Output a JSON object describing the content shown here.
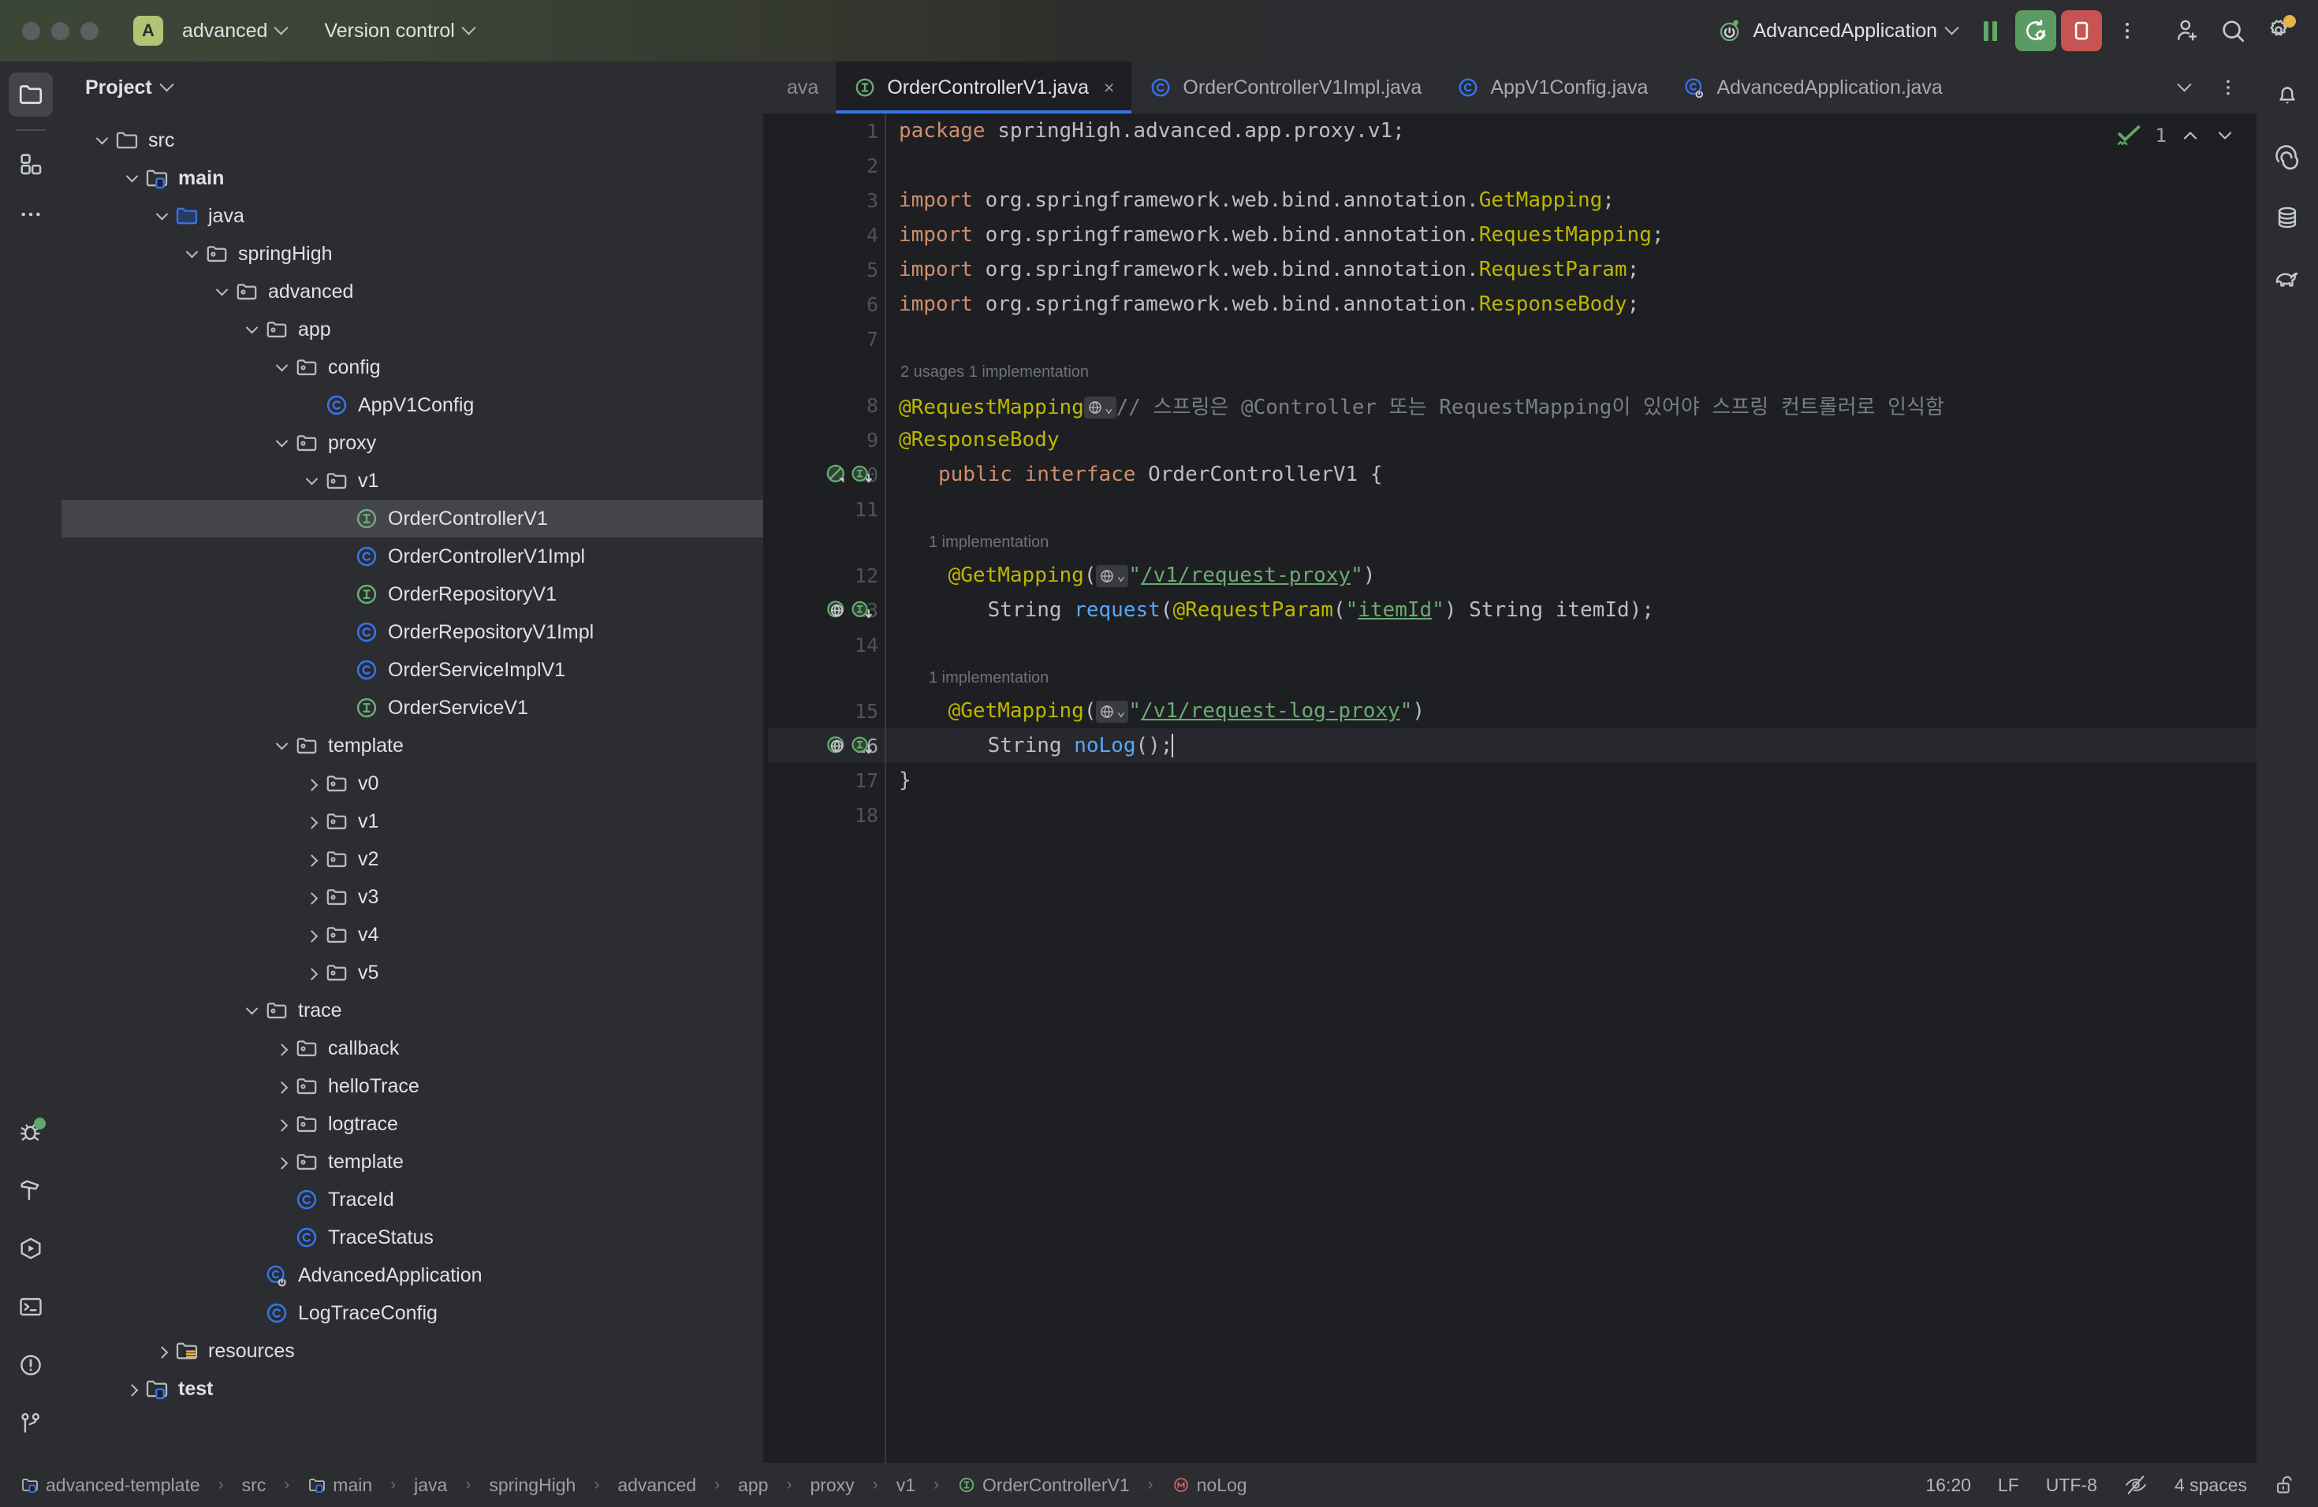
{
  "titlebar": {
    "project_badge": "A",
    "project_name": "advanced",
    "version_control": "Version control",
    "run_config": "AdvancedApplication",
    "icons": {
      "pause": "pause-icon",
      "rerun": "rerun-with-debug-icon",
      "stop": "stop-icon",
      "more": "more-vertical-icon",
      "add_user": "add-user-icon",
      "search": "search-icon",
      "settings": "settings-gear-icon"
    }
  },
  "left_strip": {
    "top": [
      "project-icon",
      "commit-icon",
      "more-tool-windows-icon"
    ],
    "bottom": [
      "debug-icon",
      "build-icon",
      "run-icon",
      "terminal-icon",
      "problems-icon",
      "version-control-icon"
    ]
  },
  "right_strip": [
    "notifications-bell-icon",
    "spring-icon",
    "database-icon",
    "gradle-elephant-icon"
  ],
  "project_panel": {
    "title": "Project",
    "tree": [
      {
        "label": "src",
        "depth": 0,
        "arrow": "down",
        "icon": "folder",
        "bold": false,
        "selected": false
      },
      {
        "label": "main",
        "depth": 1,
        "arrow": "down",
        "icon": "module",
        "bold": true,
        "selected": false
      },
      {
        "label": "java",
        "depth": 2,
        "arrow": "down",
        "icon": "source-root",
        "bold": false,
        "selected": false
      },
      {
        "label": "springHigh",
        "depth": 3,
        "arrow": "down",
        "icon": "package",
        "bold": false,
        "selected": false
      },
      {
        "label": "advanced",
        "depth": 4,
        "arrow": "down",
        "icon": "package",
        "bold": false,
        "selected": false
      },
      {
        "label": "app",
        "depth": 5,
        "arrow": "down",
        "icon": "package",
        "bold": false,
        "selected": false
      },
      {
        "label": "config",
        "depth": 6,
        "arrow": "down",
        "icon": "package",
        "bold": false,
        "selected": false
      },
      {
        "label": "AppV1Config",
        "depth": 7,
        "arrow": "none",
        "icon": "class",
        "bold": false,
        "selected": false
      },
      {
        "label": "proxy",
        "depth": 6,
        "arrow": "down",
        "icon": "package",
        "bold": false,
        "selected": false
      },
      {
        "label": "v1",
        "depth": 7,
        "arrow": "down",
        "icon": "package",
        "bold": false,
        "selected": false
      },
      {
        "label": "OrderControllerV1",
        "depth": 8,
        "arrow": "none",
        "icon": "interface",
        "bold": false,
        "selected": true
      },
      {
        "label": "OrderControllerV1Impl",
        "depth": 8,
        "arrow": "none",
        "icon": "class",
        "bold": false,
        "selected": false
      },
      {
        "label": "OrderRepositoryV1",
        "depth": 8,
        "arrow": "none",
        "icon": "interface",
        "bold": false,
        "selected": false
      },
      {
        "label": "OrderRepositoryV1Impl",
        "depth": 8,
        "arrow": "none",
        "icon": "class",
        "bold": false,
        "selected": false
      },
      {
        "label": "OrderServiceImplV1",
        "depth": 8,
        "arrow": "none",
        "icon": "class",
        "bold": false,
        "selected": false
      },
      {
        "label": "OrderServiceV1",
        "depth": 8,
        "arrow": "none",
        "icon": "interface",
        "bold": false,
        "selected": false
      },
      {
        "label": "template",
        "depth": 6,
        "arrow": "down",
        "icon": "package",
        "bold": false,
        "selected": false
      },
      {
        "label": "v0",
        "depth": 7,
        "arrow": "right",
        "icon": "package",
        "bold": false,
        "selected": false
      },
      {
        "label": "v1",
        "depth": 7,
        "arrow": "right",
        "icon": "package",
        "bold": false,
        "selected": false
      },
      {
        "label": "v2",
        "depth": 7,
        "arrow": "right",
        "icon": "package",
        "bold": false,
        "selected": false
      },
      {
        "label": "v3",
        "depth": 7,
        "arrow": "right",
        "icon": "package",
        "bold": false,
        "selected": false
      },
      {
        "label": "v4",
        "depth": 7,
        "arrow": "right",
        "icon": "package",
        "bold": false,
        "selected": false
      },
      {
        "label": "v5",
        "depth": 7,
        "arrow": "right",
        "icon": "package",
        "bold": false,
        "selected": false
      },
      {
        "label": "trace",
        "depth": 5,
        "arrow": "down",
        "icon": "package",
        "bold": false,
        "selected": false
      },
      {
        "label": "callback",
        "depth": 6,
        "arrow": "right",
        "icon": "package",
        "bold": false,
        "selected": false
      },
      {
        "label": "helloTrace",
        "depth": 6,
        "arrow": "right",
        "icon": "package",
        "bold": false,
        "selected": false
      },
      {
        "label": "logtrace",
        "depth": 6,
        "arrow": "right",
        "icon": "package",
        "bold": false,
        "selected": false
      },
      {
        "label": "template",
        "depth": 6,
        "arrow": "right",
        "icon": "package",
        "bold": false,
        "selected": false
      },
      {
        "label": "TraceId",
        "depth": 6,
        "arrow": "none",
        "icon": "class",
        "bold": false,
        "selected": false
      },
      {
        "label": "TraceStatus",
        "depth": 6,
        "arrow": "none",
        "icon": "class",
        "bold": false,
        "selected": false
      },
      {
        "label": "AdvancedApplication",
        "depth": 5,
        "arrow": "none",
        "icon": "spring-class",
        "bold": false,
        "selected": false
      },
      {
        "label": "LogTraceConfig",
        "depth": 5,
        "arrow": "none",
        "icon": "class",
        "bold": false,
        "selected": false
      },
      {
        "label": "resources",
        "depth": 2,
        "arrow": "right",
        "icon": "resources",
        "bold": false,
        "selected": false
      },
      {
        "label": "test",
        "depth": 1,
        "arrow": "right",
        "icon": "module",
        "bold": true,
        "selected": false
      }
    ]
  },
  "editor_tabs": {
    "partial_label": "ava",
    "tabs": [
      {
        "label": "OrderControllerV1.java",
        "icon": "interface",
        "active": true,
        "closable": true
      },
      {
        "label": "OrderControllerV1Impl.java",
        "icon": "class",
        "active": false,
        "closable": false
      },
      {
        "label": "AppV1Config.java",
        "icon": "class",
        "active": false,
        "closable": false
      },
      {
        "label": "AdvancedApplication.java",
        "icon": "spring-class",
        "active": false,
        "closable": false
      }
    ],
    "overflow_icon": "chevron-down-icon",
    "options_icon": "more-vertical-icon"
  },
  "inspection_widget": {
    "count": "1",
    "check_icon": "inspection-ok-icon",
    "prev_icon": "chevron-up-icon",
    "next_icon": "chevron-down-icon"
  },
  "code": {
    "current_line": 16,
    "lines": [
      {
        "n": 1,
        "hint": null,
        "gutter": []
      },
      {
        "n": 2,
        "hint": null,
        "gutter": []
      },
      {
        "n": 3,
        "hint": null,
        "gutter": []
      },
      {
        "n": 4,
        "hint": null,
        "gutter": []
      },
      {
        "n": 5,
        "hint": null,
        "gutter": []
      },
      {
        "n": 6,
        "hint": null,
        "gutter": []
      },
      {
        "n": 7,
        "hint": null,
        "gutter": []
      },
      {
        "n": 8,
        "hint": "2 usages  1 implementation",
        "gutter": []
      },
      {
        "n": 9,
        "hint": null,
        "gutter": []
      },
      {
        "n": 10,
        "hint": null,
        "gutter": [
          "no-instance-icon",
          "implemented-by-icon"
        ]
      },
      {
        "n": 11,
        "hint": null,
        "gutter": []
      },
      {
        "n": 12,
        "hint": "1 implementation",
        "gutter": []
      },
      {
        "n": 13,
        "hint": null,
        "gutter": [
          "web-mapping-icon",
          "implemented-by-icon"
        ]
      },
      {
        "n": 14,
        "hint": null,
        "gutter": []
      },
      {
        "n": 15,
        "hint": "1 implementation",
        "gutter": []
      },
      {
        "n": 16,
        "hint": null,
        "gutter": [
          "web-mapping-icon",
          "implemented-by-icon"
        ]
      },
      {
        "n": 17,
        "hint": null,
        "gutter": []
      },
      {
        "n": 18,
        "hint": null,
        "gutter": []
      }
    ],
    "text": {
      "l1_package_kw": "package",
      "l1_package_name": " springHigh.advanced.app.proxy.v1;",
      "l3_import_kw": "import",
      "l3_path": " org.springframework.web.bind.annotation.",
      "l3_cls": "GetMapping",
      "l4_cls": "RequestMapping",
      "l5_cls": "RequestParam",
      "l6_cls": "ResponseBody",
      "semi": ";",
      "l8_anno": "@RequestMapping",
      "l8_comment": "// 스프링은 @Controller 또는 RequestMapping이 있어야 스프링 컨트롤러로 인식함",
      "l9_anno": "@ResponseBody",
      "l10_public": "public",
      "l10_interface": "interface",
      "l10_name": " OrderControllerV1 {",
      "l12_anno": "@GetMapping",
      "l12_paren_open": "(",
      "l12_quote": "\"",
      "l12_path": "/v1/request-proxy",
      "l12_quote_close": "\"",
      "l12_paren_close": ")",
      "l13_type": "String",
      "l13_method": "request",
      "l13_anno": "@RequestParam",
      "l13_argname": "itemId",
      "l13_rest": ") String itemId);",
      "l15_path": "/v1/request-log-proxy",
      "l16_type": "String",
      "l16_method": "noLog",
      "l16_rest": "();",
      "l17_brace": "}"
    }
  },
  "status_bar": {
    "breadcrumb": [
      {
        "label": "advanced-template",
        "icon": "module"
      },
      {
        "label": "src",
        "icon": null
      },
      {
        "label": "main",
        "icon": "module"
      },
      {
        "label": "java",
        "icon": null
      },
      {
        "label": "springHigh",
        "icon": null
      },
      {
        "label": "advanced",
        "icon": null
      },
      {
        "label": "app",
        "icon": null
      },
      {
        "label": "proxy",
        "icon": null
      },
      {
        "label": "v1",
        "icon": null
      },
      {
        "label": "OrderControllerV1",
        "icon": "interface"
      },
      {
        "label": "noLog",
        "icon": "method"
      }
    ],
    "separator": "›",
    "position": "16:20",
    "line_separator": "LF",
    "encoding": "UTF-8",
    "indent": "4 spaces",
    "lock_icon": "unlocked-icon",
    "readonly_icon": "no-access-icon"
  },
  "colors": {
    "accent_blue": "#3574f0",
    "run_green": "#5c9a63",
    "stop_red": "#c75450",
    "badge_green": "#b3c375",
    "panel_bg": "#2b2d30",
    "editor_bg": "#1e1f22",
    "selection": "#43454a"
  }
}
